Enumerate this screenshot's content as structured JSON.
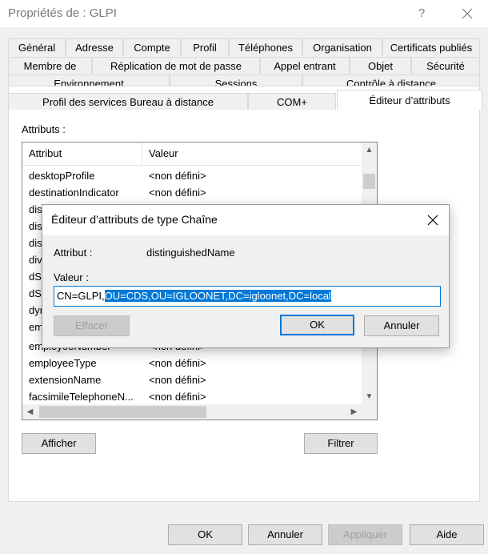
{
  "window": {
    "title": "Propriétés de : GLPI",
    "help_glyph": "?"
  },
  "tabs": {
    "row1": [
      "Général",
      "Adresse",
      "Compte",
      "Profil",
      "Téléphones",
      "Organisation",
      "Certificats publiés"
    ],
    "row2": [
      "Membre de",
      "Réplication de mot de passe",
      "Appel entrant",
      "Objet",
      "Sécurité"
    ],
    "row3": [
      "Environnement",
      "Sessions",
      "Contrôle à distance"
    ],
    "row4": [
      "Profil des services Bureau à distance",
      "COM+",
      "Éditeur d’attributs"
    ],
    "active": "Éditeur d’attributs"
  },
  "attributes_label": "Attributs :",
  "list": {
    "headers": [
      "Attribut",
      "Valeur"
    ],
    "rows": [
      {
        "attr": "desktopProfile",
        "value": "<non défini>"
      },
      {
        "attr": "destinationIndicator",
        "value": "<non défini>"
      },
      {
        "attr": "dis",
        "value": ""
      },
      {
        "attr": "dis",
        "value": ""
      },
      {
        "attr": "dis",
        "value": ""
      },
      {
        "attr": "div",
        "value": ""
      },
      {
        "attr": "dS",
        "value": ""
      },
      {
        "attr": "dS",
        "value": ""
      },
      {
        "attr": "dyr",
        "value": ""
      },
      {
        "attr": "em",
        "value": ""
      },
      {
        "attr": "employeeNumber",
        "value": "<non défini>"
      },
      {
        "attr": "employeeType",
        "value": "<non défini>"
      },
      {
        "attr": "extensionName",
        "value": "<non défini>"
      },
      {
        "attr": "facsimileTelephoneN...",
        "value": "<non défini>"
      }
    ]
  },
  "panel_buttons": {
    "show": "Afficher",
    "filter": "Filtrer"
  },
  "footer_buttons": {
    "ok": "OK",
    "cancel": "Annuler",
    "apply": "Appliquer",
    "help": "Aide"
  },
  "dialog": {
    "title": "Éditeur d’attributs de type Chaîne",
    "attribute_label": "Attribut :",
    "attribute_value": "distinguishedName",
    "value_label": "Valeur :",
    "value_unselected": "CN=GLPI,",
    "value_selected": "OU=CDS,OU=IGLOONET,DC=igloonet,DC=local",
    "clear_button": "Effacer",
    "ok_button": "OK",
    "cancel_button": "Annuler"
  }
}
